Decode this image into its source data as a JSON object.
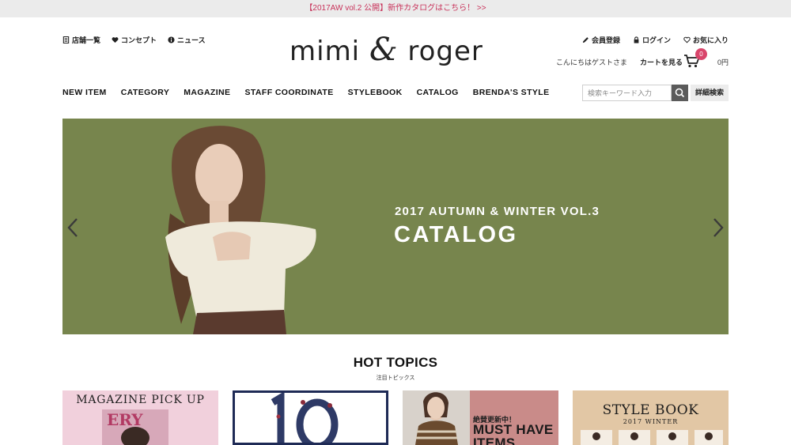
{
  "announcement": "【2017AW vol.2 公開】新作カタログはこちら！ >>",
  "utility_left": [
    {
      "label": "店舗一覧",
      "icon": "shop-list-icon"
    },
    {
      "label": "コンセプト",
      "icon": "heart-icon"
    },
    {
      "label": "ニュース",
      "icon": "info-icon"
    }
  ],
  "logo": {
    "part1": "mimi ",
    "amp": "&",
    "part2": " roger"
  },
  "utility_right": [
    {
      "label": "会員登録",
      "icon": "pencil-icon"
    },
    {
      "label": "ログイン",
      "icon": "lock-icon"
    },
    {
      "label": "お気に入り",
      "icon": "heart-outline-icon"
    }
  ],
  "greeting": "こんにちはゲストさま",
  "cart": {
    "label": "カートを見る",
    "count": "0",
    "total": "0円"
  },
  "nav": [
    "NEW ITEM",
    "CATEGORY",
    "MAGAZINE",
    "STAFF COORDINATE",
    "STYLEBOOK",
    "CATALOG",
    "BRENDA'S STYLE"
  ],
  "search": {
    "placeholder": "検索キーワード入力",
    "advanced_label": "詳細検索"
  },
  "hero": {
    "subtitle": "2017 AUTUMN & WINTER VOL.3",
    "title": "CATALOG",
    "bg_color": "#77854d"
  },
  "hot_topics": {
    "title": "HOT TOPICS",
    "subtitle": "注目トピックス",
    "tiles": [
      {
        "label": "MAGAZINE PICK UP"
      },
      {
        "label": ""
      },
      {
        "small": "絶賛更新中！",
        "big": "MUST HAVE ITEMS"
      },
      {
        "label": "STYLE BOOK",
        "label2": "2017 WINTER"
      }
    ]
  },
  "colors": {
    "accent": "#d9456b",
    "announce_text": "#c8325a",
    "tile_navy": "#1e2a55"
  }
}
